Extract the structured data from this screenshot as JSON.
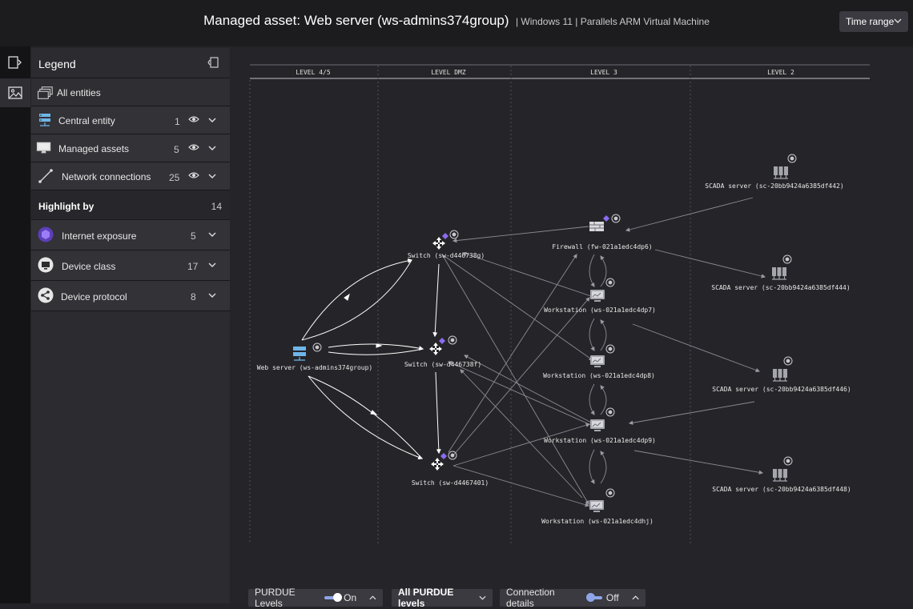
{
  "header": {
    "title": "Managed asset: Web server (ws-admins374group)",
    "subtitle": "| Windows 11 | Parallels ARM Virtual Machine",
    "time_range_label": "Time range"
  },
  "legend": {
    "title": "Legend",
    "all_entities": "All entities",
    "rows": [
      {
        "label": "Central entity",
        "count": "1",
        "icon": "server-stack-icon"
      },
      {
        "label": "Managed assets",
        "count": "5",
        "icon": "monitor-icon"
      },
      {
        "label": "Network connections",
        "count": "25",
        "icon": "connection-line-icon"
      }
    ],
    "highlight_by": {
      "label": "Highlight by",
      "count": "14"
    },
    "highlight_rows": [
      {
        "label": "Internet exposure",
        "count": "5",
        "icon": "hexagon-icon"
      },
      {
        "label": "Device class",
        "count": "17",
        "icon": "device-class-icon"
      },
      {
        "label": "Device protocol",
        "count": "8",
        "icon": "protocol-icon"
      }
    ]
  },
  "graph": {
    "levels": [
      "LEVEL 4/5",
      "LEVEL DMZ",
      "LEVEL 3",
      "LEVEL 2"
    ],
    "nodes": [
      {
        "id": "web",
        "label": "Web server (ws-admins374group)",
        "type": "server"
      },
      {
        "id": "sw1",
        "label": "Switch (sw-d446738g)",
        "type": "switch"
      },
      {
        "id": "sw2",
        "label": "Switch (sw-d446738f)",
        "type": "switch"
      },
      {
        "id": "sw3",
        "label": "Switch (sw-d4467401)",
        "type": "switch"
      },
      {
        "id": "fw",
        "label": "Firewall (fw-021a1edc4dp6)",
        "type": "firewall"
      },
      {
        "id": "ws7",
        "label": "Workstation (ws-021a1edc4dp7)",
        "type": "workstation"
      },
      {
        "id": "ws8",
        "label": "Workstation (ws-021a1edc4dp8)",
        "type": "workstation"
      },
      {
        "id": "ws9",
        "label": "Workstation (ws-021a1edc4dp9)",
        "type": "workstation"
      },
      {
        "id": "wsh",
        "label": "Workstation (ws-021a1edc4dhj)",
        "type": "workstation"
      },
      {
        "id": "sc2",
        "label": "SCADA server (sc-20bb9424a6385df442)",
        "type": "scada"
      },
      {
        "id": "sc4",
        "label": "SCADA server (sc-20bb9424a6385df444)",
        "type": "scada"
      },
      {
        "id": "sc6",
        "label": "SCADA server (sc-20bb9424a6385df446)",
        "type": "scada"
      },
      {
        "id": "sc8",
        "label": "SCADA server (sc-20bb9424a6385df448)",
        "type": "scada"
      }
    ]
  },
  "bottom": {
    "purdue_label": "PURDUE Levels",
    "purdue_state": "On",
    "all_levels_label": "All PURDUE levels",
    "connection_label": "Connection details",
    "connection_state": "Off"
  },
  "colors": {
    "accent": "#8fa5e8",
    "entity_purple": "#8b6cf0",
    "background": "#242428"
  }
}
